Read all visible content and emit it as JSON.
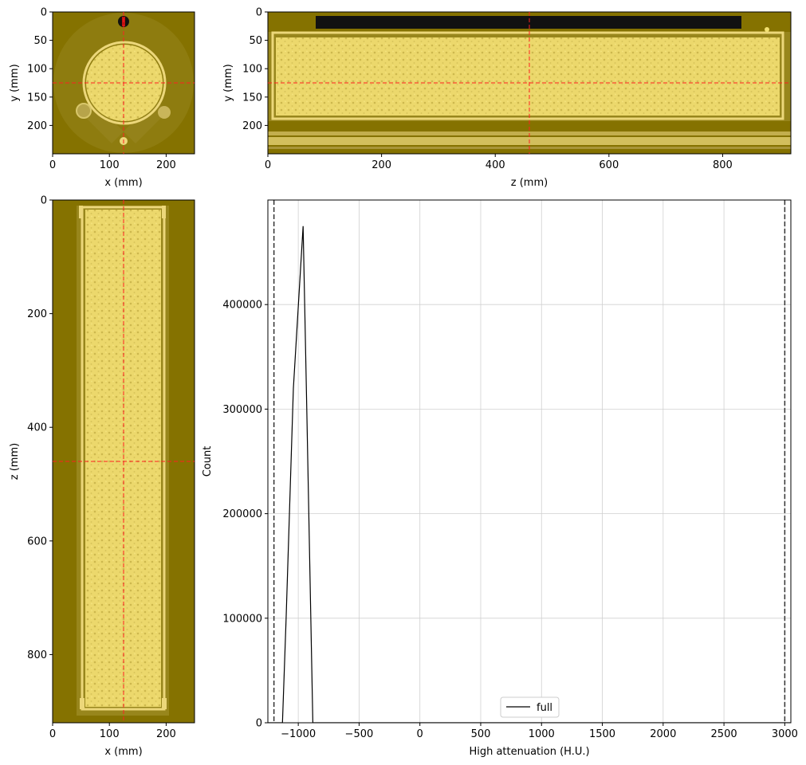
{
  "colors": {
    "background": "#857200",
    "sample": "#e8d56a",
    "sample_light": "#f2e06f",
    "crosshair": "#ff2020",
    "hist_line": "#000000",
    "threshold_line": "#333333",
    "grid": "#d0d0d0",
    "label_bar": "#111111"
  },
  "chart_data": [
    {
      "id": "xy-slice",
      "type": "image",
      "xlabel": "x (mm)",
      "ylabel": "y (mm)",
      "xlim": [
        0,
        250
      ],
      "ylim": [
        250,
        0
      ],
      "xticks": [
        0,
        100,
        200
      ],
      "yticks": [
        0,
        50,
        100,
        150,
        200
      ],
      "crosshair": {
        "x": 125,
        "y": 125
      }
    },
    {
      "id": "zy-slice",
      "type": "image",
      "xlabel": "z (mm)",
      "ylabel": "y (mm)",
      "xlim": [
        0,
        920
      ],
      "ylim": [
        250,
        0
      ],
      "xticks": [
        0,
        200,
        400,
        600,
        800
      ],
      "yticks": [
        0,
        50,
        100,
        150,
        200
      ],
      "crosshair": {
        "x": 460,
        "y": 125
      }
    },
    {
      "id": "xz-slice",
      "type": "image",
      "xlabel": "x (mm)",
      "ylabel": "z (mm)",
      "xlim": [
        0,
        250
      ],
      "ylim": [
        920,
        0
      ],
      "xticks": [
        0,
        100,
        200
      ],
      "yticks": [
        0,
        200,
        400,
        600,
        800
      ],
      "crosshair": {
        "x": 125,
        "y": 460
      }
    },
    {
      "id": "histogram",
      "type": "line",
      "xlabel": "High attenuation (H.U.)",
      "ylabel": "Count",
      "xlim": [
        -1250,
        3050
      ],
      "ylim": [
        0,
        500000
      ],
      "xticks": [
        -1000,
        -500,
        0,
        500,
        1000,
        1500,
        2000,
        2500,
        3000
      ],
      "xtick_labels": [
        "−1000",
        "−500",
        "0",
        "500",
        "1000",
        "1500",
        "2000",
        "2500",
        "3000"
      ],
      "yticks": [
        0,
        100000,
        200000,
        300000,
        400000
      ],
      "grid": true,
      "legend": "lower center",
      "series": [
        {
          "name": "full",
          "x": [
            -1250,
            -1200,
            -1130,
            -1100,
            -1040,
            -960,
            -930,
            -880,
            -860,
            0,
            3050
          ],
          "y": [
            0,
            0,
            0,
            100000,
            320000,
            475000,
            300000,
            0,
            0,
            0,
            0
          ]
        }
      ],
      "vlines": [
        -1200,
        3000
      ]
    }
  ]
}
